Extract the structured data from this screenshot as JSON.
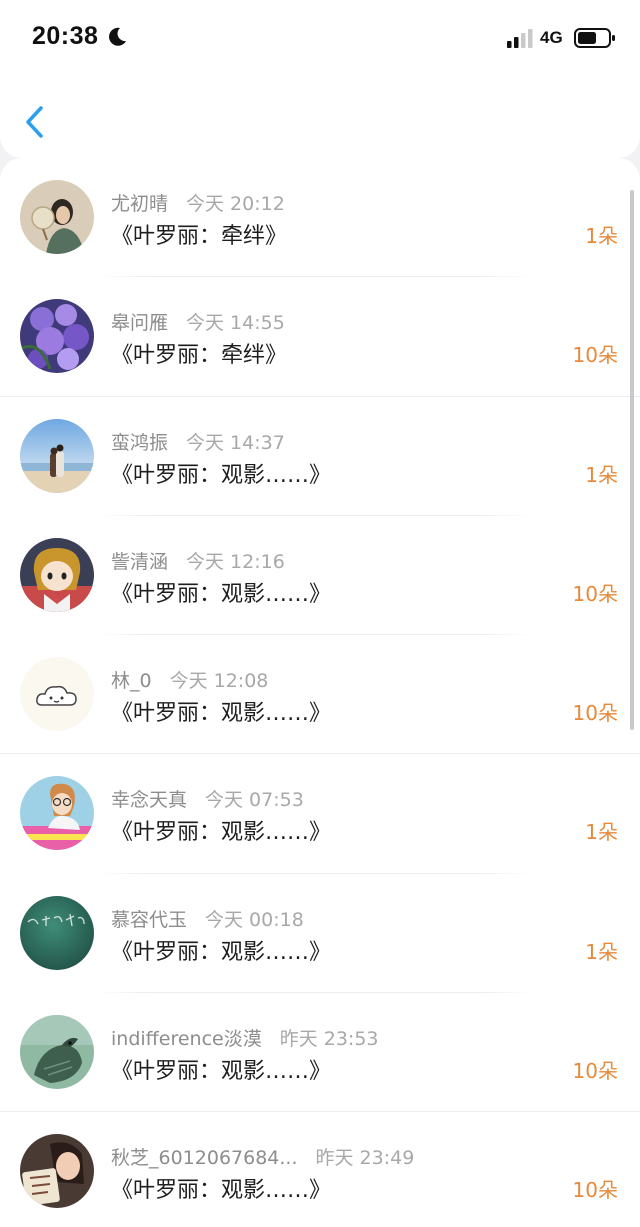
{
  "status_bar": {
    "time": "20:38",
    "network": "4G",
    "icons": [
      "moon-icon",
      "signal-icon",
      "battery-icon"
    ]
  },
  "nav": {
    "back_icon": "chevron-left-icon",
    "accent": "#2a9ff0"
  },
  "colors": {
    "count": "#e8893a",
    "name": "#8d8d8d",
    "title": "#1e1e1e"
  },
  "rows": [
    {
      "name": "尤初晴",
      "time": "今天 20:12",
      "title": "《叶罗丽：牵绊》",
      "count": "1朵",
      "avatar": "woman-with-fan"
    },
    {
      "name": "皋问雁",
      "time": "今天 14:55",
      "title": "《叶罗丽：牵绊》",
      "count": "10朵",
      "avatar": "purple-wisteria"
    },
    {
      "name": "蛮鸿振",
      "time": "今天 14:37",
      "title": "《叶罗丽：观影……》",
      "count": "1朵",
      "avatar": "couple-on-beach"
    },
    {
      "name": "訾清涵",
      "time": "今天 12:16",
      "title": "《叶罗丽：观影……》",
      "count": "10朵",
      "avatar": "anime-girl"
    },
    {
      "name": "林_0",
      "time": "今天 12:08",
      "title": "《叶罗丽：观影……》",
      "count": "10朵",
      "avatar": "cloud-face"
    },
    {
      "name": "幸念天真",
      "time": "今天 07:53",
      "title": "《叶罗丽：观影……》",
      "count": "1朵",
      "avatar": "girl-with-glasses"
    },
    {
      "name": "慕容代玉",
      "time": "今天 00:18",
      "title": "《叶罗丽：观影……》",
      "count": "1朵",
      "avatar": "green-chalkboard"
    },
    {
      "name": "indifference淡漠",
      "time": "昨天 23:53",
      "title": "《叶罗丽：观影……》",
      "count": "10朵",
      "avatar": "green-bird"
    },
    {
      "name": "秋芝_6012067684...",
      "time": "昨天 23:49",
      "title": "《叶罗丽：观影……》",
      "count": "10朵",
      "avatar": "girl-with-sign"
    }
  ]
}
